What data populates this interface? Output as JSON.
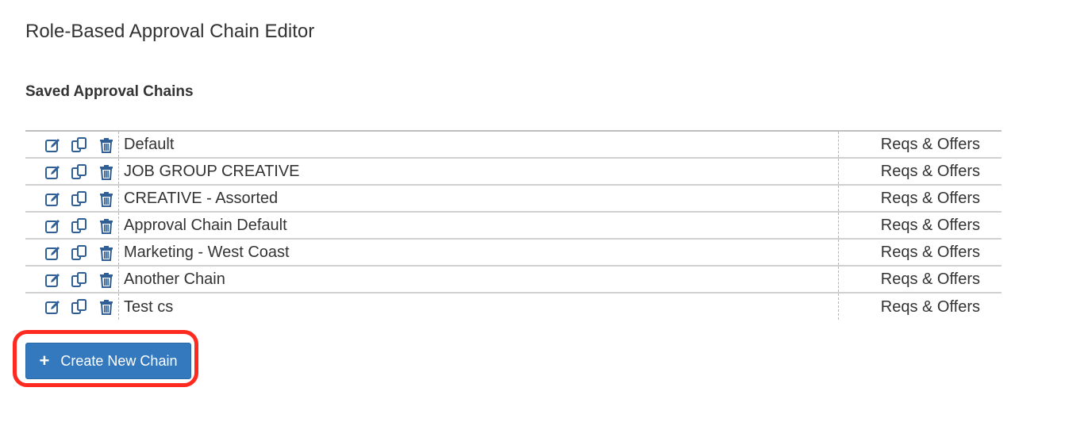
{
  "page": {
    "title": "Role-Based Approval Chain Editor",
    "section_title": "Saved Approval Chains"
  },
  "chains": [
    {
      "name": "Default",
      "type": "Reqs & Offers"
    },
    {
      "name": "JOB GROUP CREATIVE",
      "type": "Reqs & Offers"
    },
    {
      "name": "CREATIVE - Assorted",
      "type": "Reqs & Offers"
    },
    {
      "name": "Approval Chain Default",
      "type": "Reqs & Offers"
    },
    {
      "name": "Marketing - West Coast",
      "type": "Reqs & Offers"
    },
    {
      "name": "Another Chain",
      "type": "Reqs & Offers"
    },
    {
      "name": "Test cs",
      "type": "Reqs & Offers"
    }
  ],
  "row_icons": [
    "edit-icon",
    "copy-icon",
    "trash-icon"
  ],
  "create_button": {
    "label": "Create New Chain",
    "icon": "plus-icon",
    "plus_glyph": "+"
  },
  "colors": {
    "icon": "#2f5f95",
    "button": "#3478bd",
    "highlight": "#ff2a1f"
  }
}
